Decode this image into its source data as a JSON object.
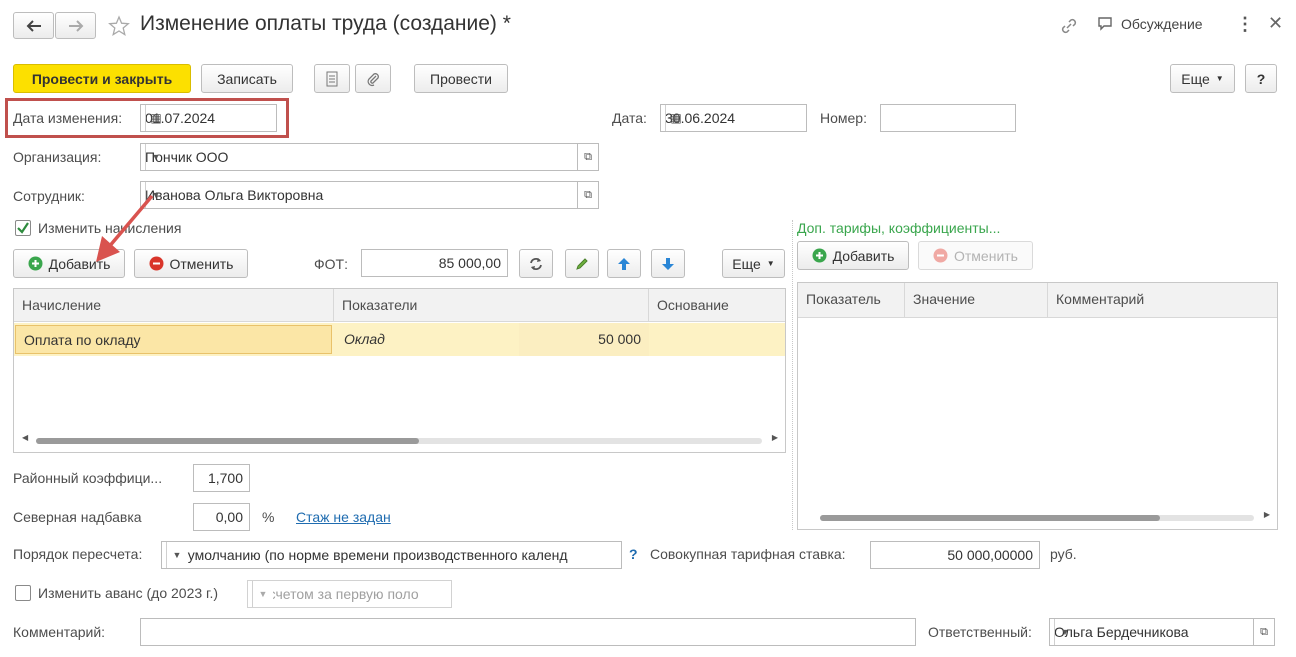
{
  "window": {
    "title": "Изменение оплаты труда (создание) *",
    "discussion_label": "Обсуждение"
  },
  "toolbar": {
    "post_close": "Провести и закрыть",
    "save": "Записать",
    "post": "Провести",
    "more": "Еще",
    "help": "?"
  },
  "header": {
    "change_date_label": "Дата изменения:",
    "change_date": "01.07.2024",
    "date_label": "Дата:",
    "date": "30.06.2024",
    "number_label": "Номер:",
    "number": ""
  },
  "fields": {
    "org_label": "Организация:",
    "org": "Пончик ООО",
    "employee_label": "Сотрудник:",
    "employee": "Иванова Ольга Викторовна"
  },
  "accruals": {
    "change_label": "Изменить начисления",
    "add": "Добавить",
    "cancel": "Отменить",
    "fot_label": "ФОТ:",
    "fot": "85 000,00",
    "more": "Еще",
    "columns": [
      "Начисление",
      "Показатели",
      "Основание"
    ],
    "rows": [
      {
        "accrual": "Оплата по окладу",
        "indicator": "Оклад",
        "value": "50 000",
        "basis": ""
      }
    ]
  },
  "extra": {
    "title": "Доп. тарифы, коэффициенты...",
    "add": "Добавить",
    "cancel": "Отменить",
    "columns": [
      "Показатель",
      "Значение",
      "Комментарий"
    ]
  },
  "coefficients": {
    "district_label": "Районный коэффици...",
    "district": "1,700",
    "north_label": "Северная надбавка",
    "north": "0,00",
    "percent": "%",
    "stazh_link": "Стаж не задан"
  },
  "recalc": {
    "label": "Порядок пересчета:",
    "value": "По умолчанию (по норме времени производственного календ",
    "help": "?",
    "rate_label": "Совокупная тарифная ставка:",
    "rate": "50 000,00000",
    "currency": "руб."
  },
  "advance": {
    "label": "Изменить аванс (до 2023 г.)",
    "value": "Расчетом за первую поло"
  },
  "footer": {
    "comment_label": "Комментарий:",
    "comment": "",
    "responsible_label": "Ответственный:",
    "responsible": "Ольга Бердечникова"
  },
  "colors": {
    "primary_button": "#fce000",
    "highlight_box": "#c0504d",
    "selected_row": "#fdf2c4",
    "group_title": "#3aa64d",
    "link": "#1f6cb0"
  }
}
